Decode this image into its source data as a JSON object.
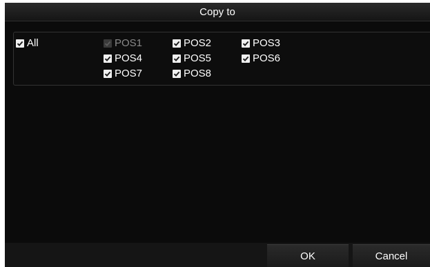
{
  "dialog": {
    "title": "Copy to"
  },
  "options": {
    "all": {
      "label": "All",
      "checked": true
    },
    "pos1": {
      "label": "POS1",
      "checked": true,
      "disabled": true
    },
    "pos2": {
      "label": "POS2",
      "checked": true
    },
    "pos3": {
      "label": "POS3",
      "checked": true
    },
    "pos4": {
      "label": "POS4",
      "checked": true
    },
    "pos5": {
      "label": "POS5",
      "checked": true
    },
    "pos6": {
      "label": "POS6",
      "checked": true
    },
    "pos7": {
      "label": "POS7",
      "checked": true
    },
    "pos8": {
      "label": "POS8",
      "checked": true
    }
  },
  "buttons": {
    "ok_label": "OK",
    "cancel_label": "Cancel"
  },
  "colors": {
    "background": "#0b0b0b",
    "checkbox_fill": "#f0f0f0",
    "check_mark": "#1a1a1a",
    "text": "#ffffff",
    "disabled_text": "#8a8a8a"
  },
  "icons": {
    "checkbox": "check-icon"
  }
}
